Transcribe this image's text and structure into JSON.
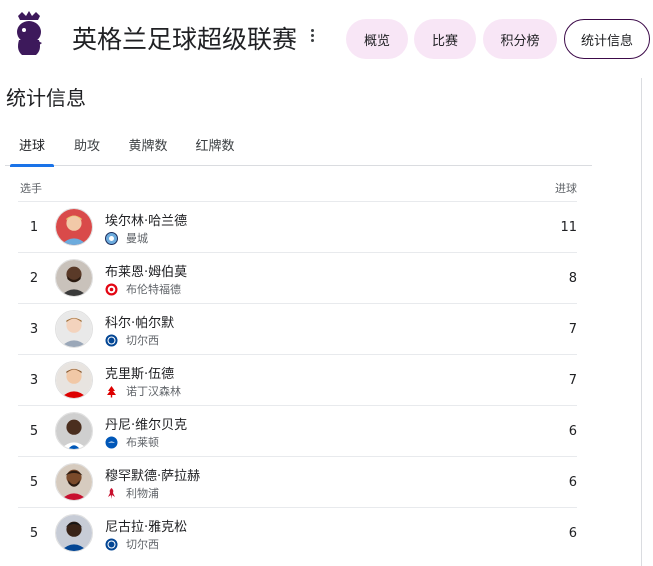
{
  "header": {
    "league_title": "英格兰足球超级联赛",
    "nav": [
      {
        "label": "概览",
        "active": false
      },
      {
        "label": "比赛",
        "active": false
      },
      {
        "label": "积分榜",
        "active": false
      },
      {
        "label": "统计信息",
        "active": true
      }
    ]
  },
  "section_title": "统计信息",
  "tabs": [
    {
      "label": "进球",
      "active": true
    },
    {
      "label": "助攻",
      "active": false
    },
    {
      "label": "黄牌数",
      "active": false
    },
    {
      "label": "红牌数",
      "active": false
    }
  ],
  "columns": {
    "player": "选手",
    "goals": "进球"
  },
  "players": [
    {
      "rank": "1",
      "name": "埃尔林·哈兰德",
      "club": "曼城",
      "goals": "11",
      "crest_icon": "manchester-city-crest-icon",
      "club_color": "#6cabdd"
    },
    {
      "rank": "2",
      "name": "布莱恩·姆伯莫",
      "club": "布伦特福德",
      "goals": "8",
      "crest_icon": "brentford-crest-icon",
      "club_color": "#e30613"
    },
    {
      "rank": "3",
      "name": "科尔·帕尔默",
      "club": "切尔西",
      "goals": "7",
      "crest_icon": "chelsea-crest-icon",
      "club_color": "#034694"
    },
    {
      "rank": "3",
      "name": "克里斯·伍德",
      "club": "诺丁汉森林",
      "goals": "7",
      "crest_icon": "nottingham-forest-crest-icon",
      "club_color": "#dd0000"
    },
    {
      "rank": "5",
      "name": "丹尼·维尔贝克",
      "club": "布莱顿",
      "goals": "6",
      "crest_icon": "brighton-crest-icon",
      "club_color": "#0057b8"
    },
    {
      "rank": "5",
      "name": "穆罕默德·萨拉赫",
      "club": "利物浦",
      "goals": "6",
      "crest_icon": "liverpool-crest-icon",
      "club_color": "#c8102e"
    },
    {
      "rank": "5",
      "name": "尼古拉·雅克松",
      "club": "切尔西",
      "goals": "6",
      "crest_icon": "chelsea-crest-icon",
      "club_color": "#034694"
    }
  ],
  "colors": {
    "league_purple": "#3d195b",
    "pill_bg": "#f8e6f6",
    "tab_indicator": "#1a73e8"
  }
}
